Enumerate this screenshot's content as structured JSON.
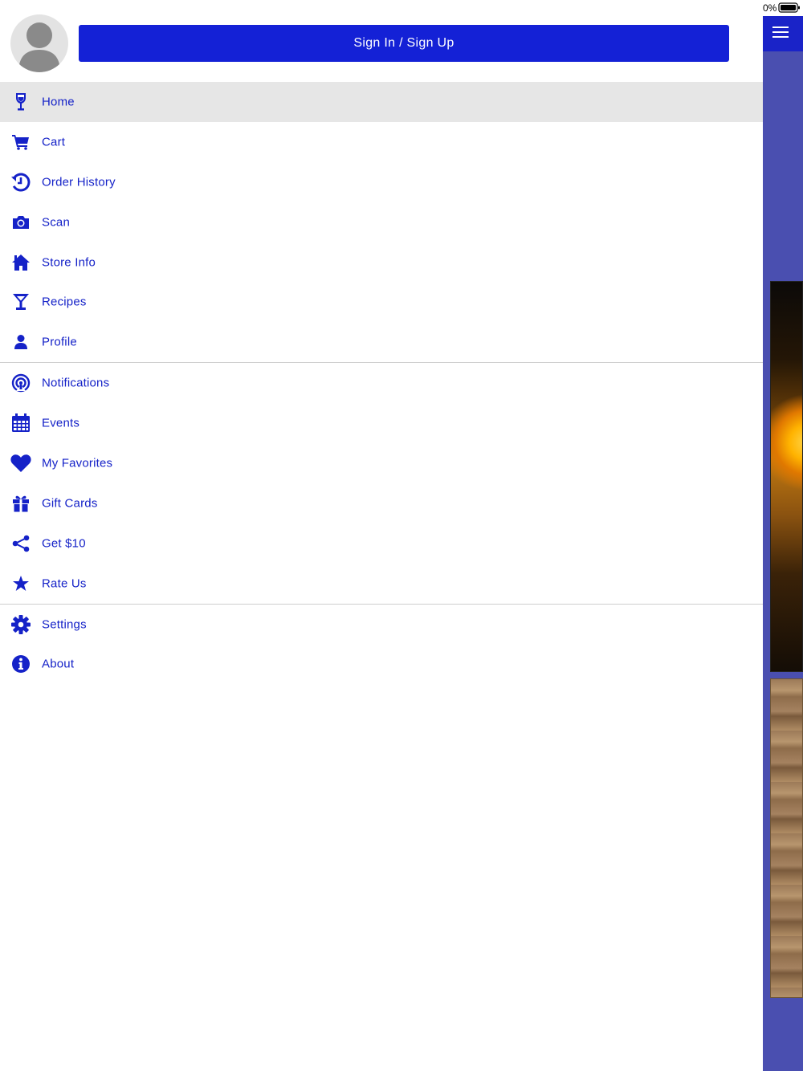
{
  "status_bar": {
    "battery_text": "0%"
  },
  "auth": {
    "sign_in_label": "Sign In / Sign Up"
  },
  "colors": {
    "accent": "#1421d6",
    "icon": "#1522c8",
    "active_bg": "#e6e6e6",
    "bg_app": "#4a4fb0"
  },
  "menu": {
    "group1": [
      {
        "label": "Home",
        "icon": "wine-glass-icon",
        "active": true
      },
      {
        "label": "Cart",
        "icon": "cart-icon"
      },
      {
        "label": "Order History",
        "icon": "history-icon"
      },
      {
        "label": "Scan",
        "icon": "camera-icon"
      },
      {
        "label": "Store Info",
        "icon": "store-icon"
      },
      {
        "label": "Recipes",
        "icon": "cocktail-icon"
      },
      {
        "label": "Profile",
        "icon": "person-icon"
      }
    ],
    "group2": [
      {
        "label": "Notifications",
        "icon": "broadcast-icon"
      },
      {
        "label": "Events",
        "icon": "calendar-icon"
      },
      {
        "label": "My Favorites",
        "icon": "heart-icon"
      },
      {
        "label": "Gift Cards",
        "icon": "gift-icon"
      },
      {
        "label": "Get $10",
        "icon": "share-icon"
      },
      {
        "label": "Rate Us",
        "icon": "star-icon"
      }
    ],
    "group3": [
      {
        "label": "Settings",
        "icon": "gear-icon"
      },
      {
        "label": "About",
        "icon": "info-icon"
      }
    ]
  }
}
